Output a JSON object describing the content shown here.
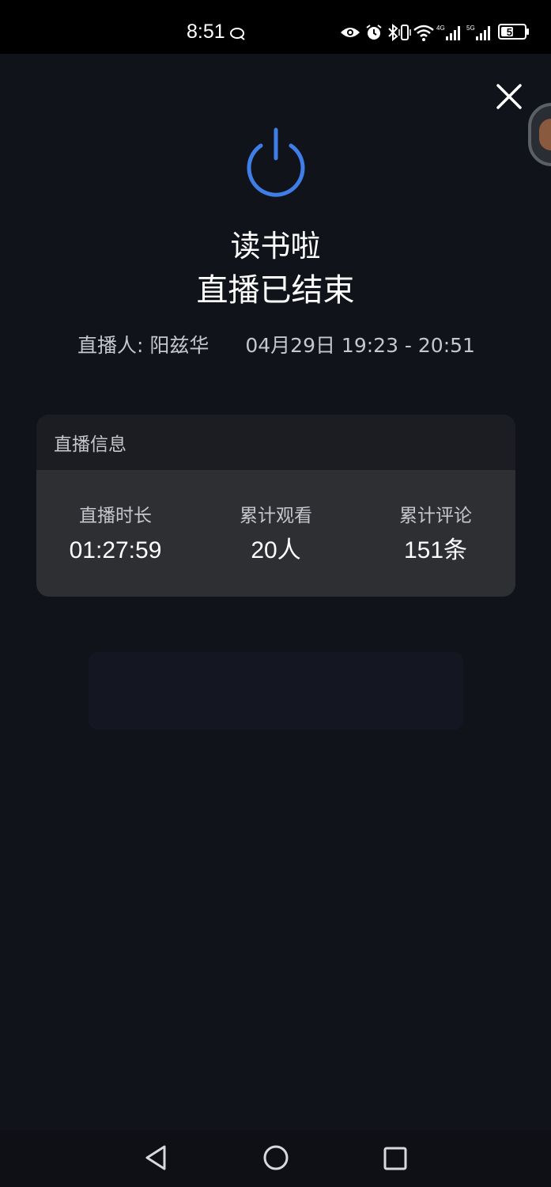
{
  "status_bar": {
    "time": "8:51",
    "battery": "55",
    "battery_level": 0.55,
    "network_1": "4G",
    "network_2": "5G",
    "icons": [
      "chat-bubble-icon",
      "eye-icon",
      "alarm-icon",
      "bluetooth-icon",
      "vibrate-icon",
      "wifi-icon",
      "signal-icon",
      "battery-icon"
    ]
  },
  "live": {
    "title": "读书啦",
    "ended_text": "直播已结束",
    "host_label": "直播人:",
    "host_name": "阳兹华",
    "time_range": "04月29日 19:23 - 20:51"
  },
  "info_card": {
    "header": "直播信息",
    "stats": [
      {
        "label": "直播时长",
        "value": "01:27:59"
      },
      {
        "label": "累计观看",
        "value": "20人"
      },
      {
        "label": "累计评论",
        "value": "151条"
      }
    ]
  },
  "colors": {
    "accent": "#3f7ee8",
    "background": "#10131a",
    "card": "#2e2f33"
  },
  "nav": {
    "icons": [
      "back-icon",
      "home-icon",
      "recent-apps-icon"
    ]
  }
}
